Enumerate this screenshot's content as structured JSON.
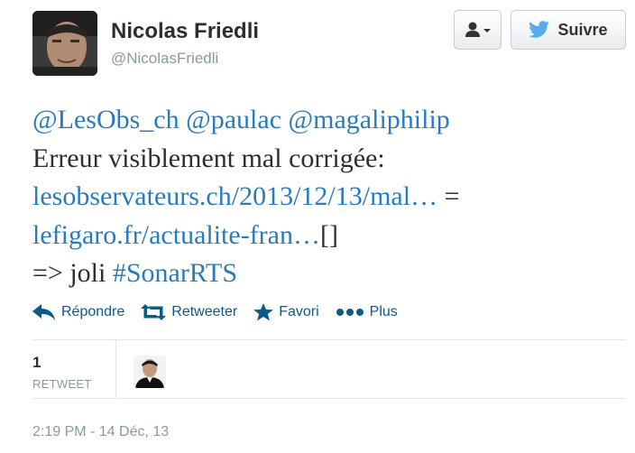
{
  "author": {
    "name": "Nicolas Friedli",
    "handle": "@NicolasFriedli"
  },
  "header_buttons": {
    "user_menu_icon": "user-dropdown-icon",
    "follow_label": "Suivre",
    "follow_icon": "bird-icon"
  },
  "tweet": {
    "mention1": "@LesObs_ch",
    "mention2": "@paulac",
    "mention3": "@magaliphilip",
    "line2": "Erreur visiblement mal corrigée:",
    "link1": "lesobservateurs.ch/2013/12/13/mal…",
    "equals": " =",
    "link2": "lefigaro.fr/actualite-fran…",
    "link2_suffix": "[]",
    "line5_prefix": "=> joli ",
    "hashtag": "#SonarRTS"
  },
  "actions": [
    {
      "label": "Répondre",
      "icon": "reply-icon"
    },
    {
      "label": "Retweeter",
      "icon": "retweet-icon"
    },
    {
      "label": "Favori",
      "icon": "star-icon"
    },
    {
      "label": "Plus",
      "icon": "more-icon"
    }
  ],
  "stats": {
    "retweet_count": "1",
    "retweet_label": "RETWEET"
  },
  "timestamp": "2:19 PM - 14 Déc, 13",
  "colors": {
    "link": "#2b7bb9",
    "action": "#0a5a8a",
    "muted": "#8899a6",
    "twitter_blue": "#55acee"
  }
}
